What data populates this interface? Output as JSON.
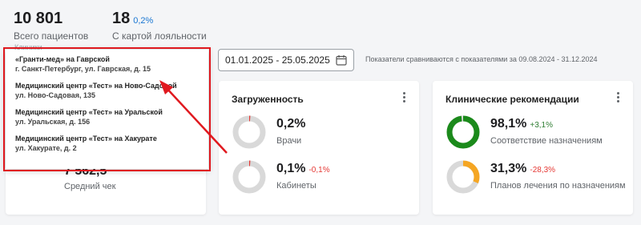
{
  "stats": [
    {
      "value": "10 801",
      "delta": "",
      "label": "Всего пациентов"
    },
    {
      "value": "18",
      "delta": "0,2%",
      "label": "С картой лояльности"
    }
  ],
  "clinics_label": "Клиники",
  "clinics": [
    {
      "name": "«Гранти-мед» на Гаврской",
      "address": "г. Санкт-Петербург, ул. Гаврская, д. 15"
    },
    {
      "name": "Медицинский центр «Тест» на Ново-Садовой",
      "address": "ул. Ново-Садовая, 135"
    },
    {
      "name": "Медицинский центр «Тест» на Уральской",
      "address": "ул. Уральская, д. 156"
    },
    {
      "name": "Медицинский центр «Тест» на Хакурате",
      "address": "ул. Хакурате, д. 2"
    }
  ],
  "date_range": "01.01.2025 - 25.05.2025",
  "compare_note": "Показатели сравниваются с показателями за 09.08.2024 - 31.12.2024",
  "average_check": {
    "value": "7 562,5",
    "label": "Средний чек"
  },
  "load_card": {
    "title": "Загруженность",
    "metrics": [
      {
        "value": "0,2%",
        "change": "",
        "label": "Врачи",
        "fraction": 0.002
      },
      {
        "value": "0,1%",
        "change": "-0,1%",
        "label": "Кабинеты",
        "fraction": 0.001
      }
    ]
  },
  "clinical_card": {
    "title": "Клинические рекомендации",
    "metrics": [
      {
        "value": "98,1%",
        "change": "+3,1%",
        "label": "Соответствие назначениям",
        "fraction": 0.981,
        "color": "#1b8a1b"
      },
      {
        "value": "31,3%",
        "change": "-28,3%",
        "label": "Планов лечения по назначениям",
        "fraction": 0.313,
        "color": "#f5a623"
      }
    ]
  },
  "colors": {
    "ring_track": "#d9d9d9",
    "load_ring": "#e53935",
    "highlight": "#e0191f"
  }
}
